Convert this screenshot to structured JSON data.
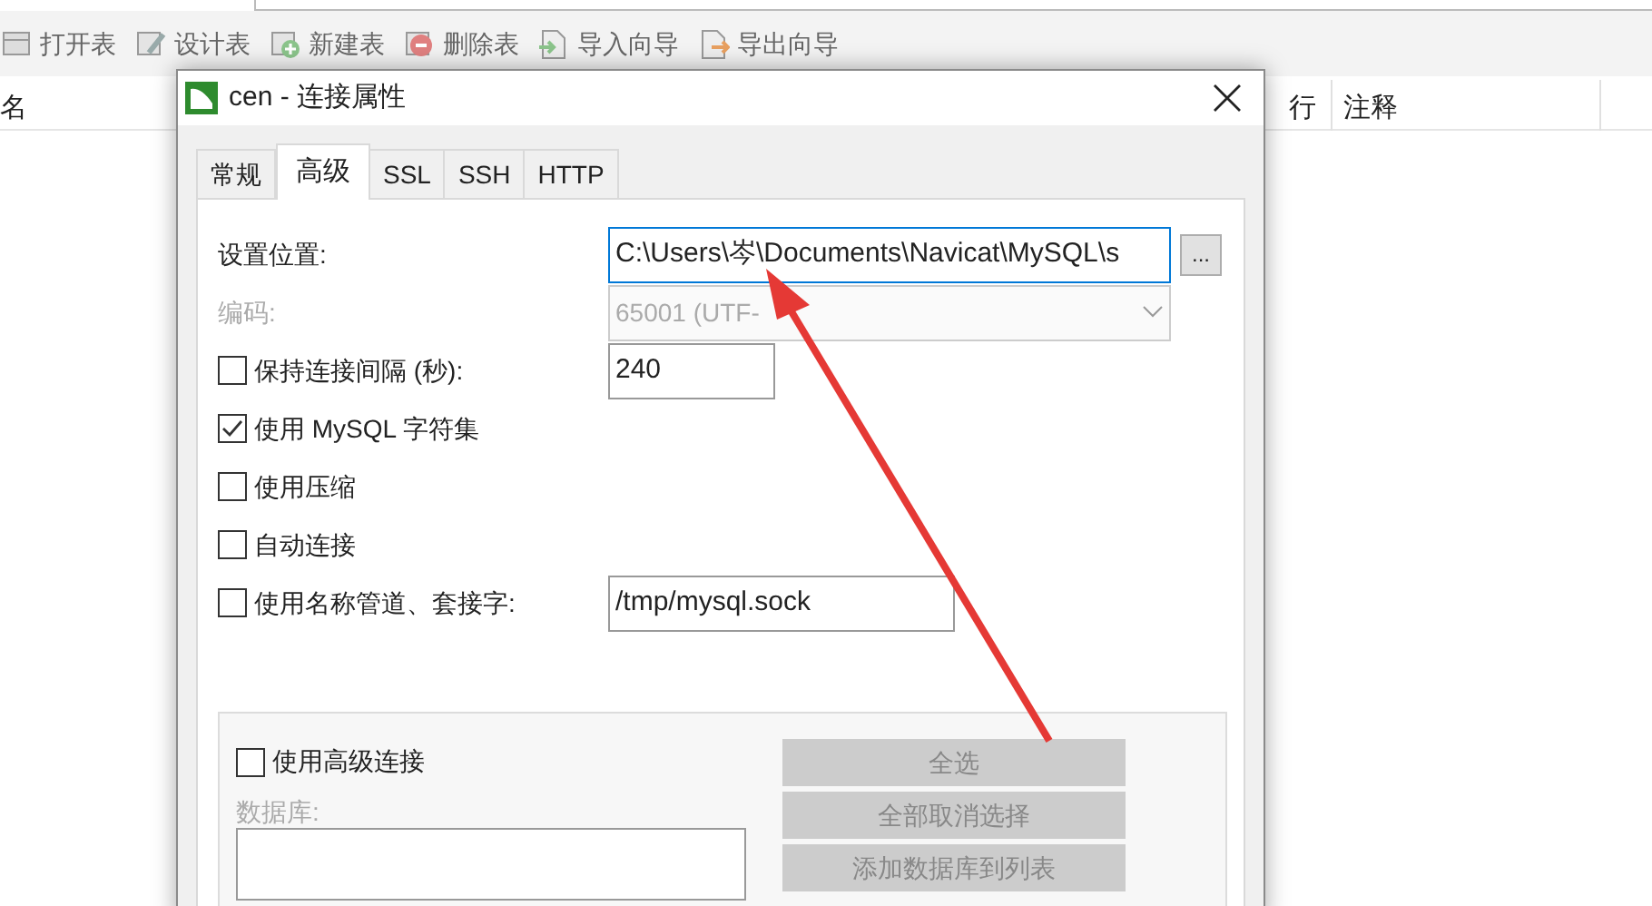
{
  "toolbar": [
    {
      "label": "打开表",
      "kind": "open"
    },
    {
      "label": "设计表",
      "kind": "design"
    },
    {
      "label": "新建表",
      "kind": "new"
    },
    {
      "label": "删除表",
      "kind": "delete"
    },
    {
      "label": "导入向导",
      "kind": "import"
    },
    {
      "label": "导出向导",
      "kind": "export"
    }
  ],
  "table": {
    "columns": [
      "名",
      "行",
      "注释"
    ]
  },
  "dialog": {
    "title": "cen - 连接属性",
    "tabs": [
      {
        "label": "常规",
        "selected": false
      },
      {
        "label": "高级",
        "selected": true
      },
      {
        "label": "SSL",
        "selected": false
      },
      {
        "label": "SSH",
        "selected": false
      },
      {
        "label": "HTTP",
        "selected": false
      }
    ],
    "settings_location": {
      "label": "设置位置:",
      "value": "C:\\Users\\岑\\Documents\\Navicat\\MySQL\\s",
      "browse": "..."
    },
    "encoding": {
      "label": "编码:",
      "value": "65001 (UTF-",
      "disabled": true
    },
    "options": [
      {
        "label": "保持连接间隔 (秒):",
        "checked": false,
        "value": "240"
      },
      {
        "label": "使用 MySQL 字符集",
        "checked": true
      },
      {
        "label": "使用压缩",
        "checked": false
      },
      {
        "label": "自动连接",
        "checked": false
      },
      {
        "label": "使用名称管道、套接字:",
        "checked": false,
        "value": "/tmp/mysql.sock"
      }
    ],
    "advanced": {
      "label": "使用高级连接",
      "checked": false,
      "databases_label": "数据库:",
      "buttons": [
        "全选",
        "全部取消选择",
        "添加数据库到列表"
      ]
    }
  }
}
